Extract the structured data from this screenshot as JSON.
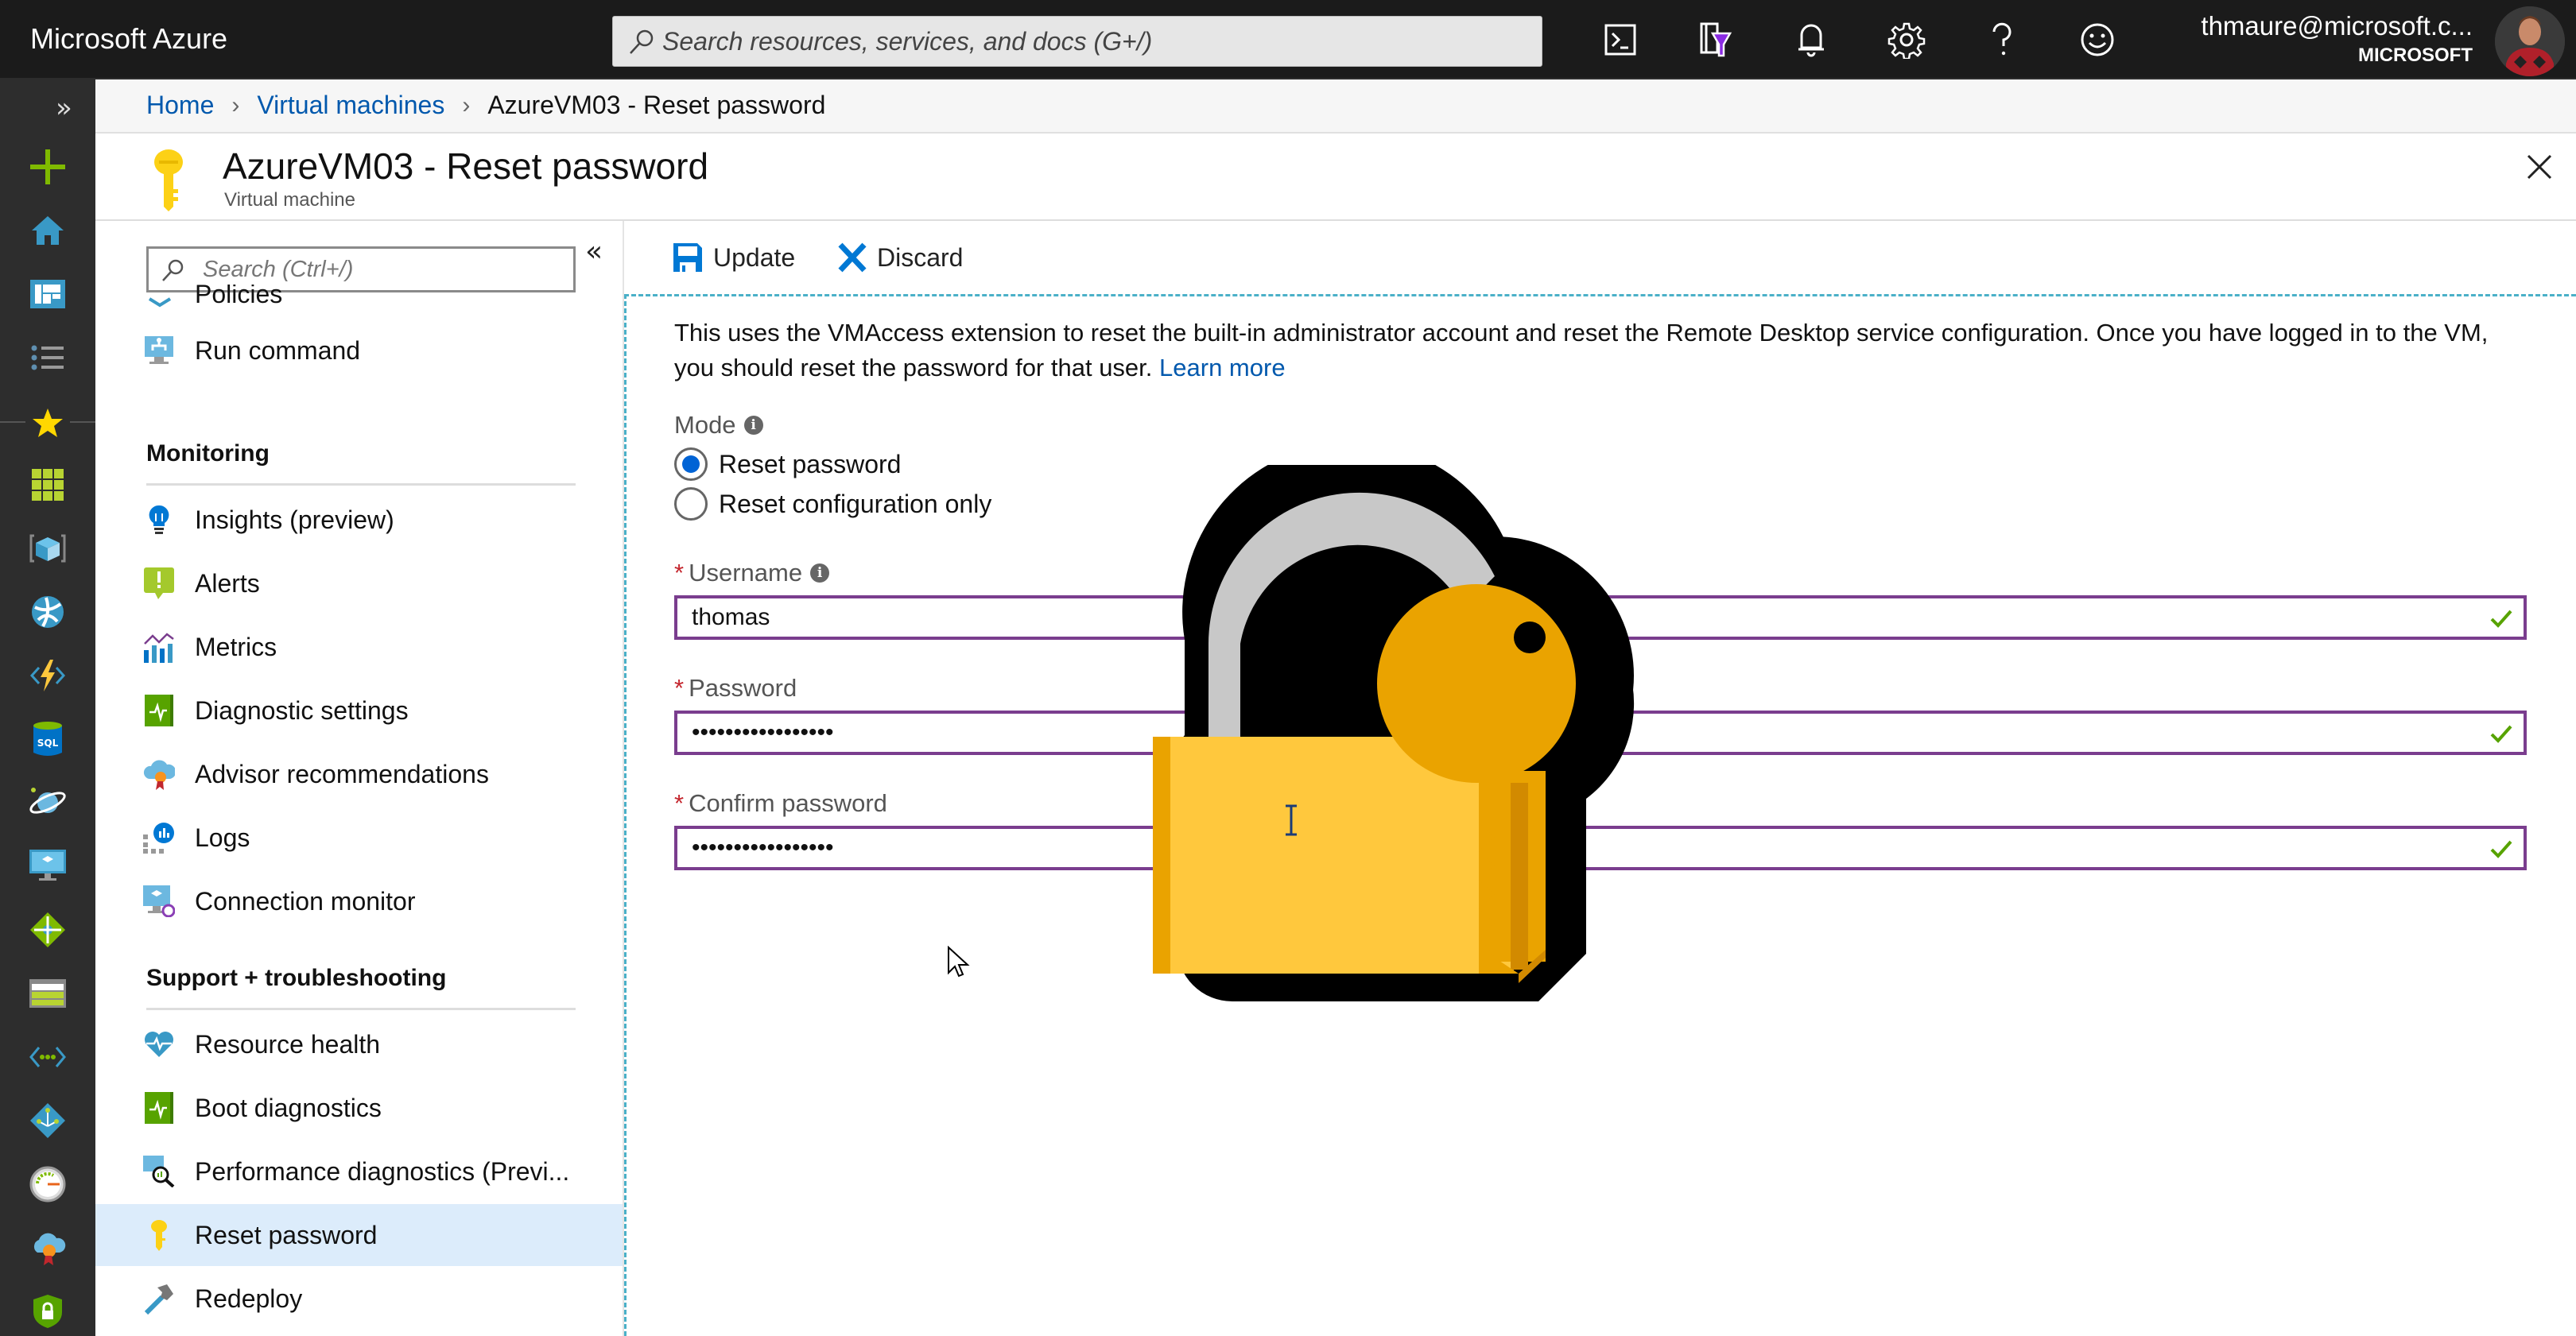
{
  "topbar": {
    "brand": "Microsoft Azure",
    "search_placeholder": "Search resources, services, and docs (G+/)",
    "icons": [
      "cloud-shell-icon",
      "directory-filter-icon",
      "notifications-icon",
      "settings-icon",
      "help-icon",
      "feedback-icon"
    ],
    "user_email": "thmaure@microsoft.c...",
    "user_org": "MICROSOFT"
  },
  "rail": {
    "expand_label": "»",
    "items": [
      {
        "name": "create-resource",
        "color": "#7fba00"
      },
      {
        "name": "home",
        "color": "#3999c6"
      },
      {
        "name": "dashboard",
        "color": "#3999c6"
      },
      {
        "name": "all-services",
        "color": "#888888"
      },
      {
        "name": "favorites",
        "color": "#ffd700"
      },
      {
        "name": "all-resources",
        "color": "#b8d432"
      },
      {
        "name": "resource-groups",
        "color": "#3999c6"
      },
      {
        "name": "app-services",
        "color": "#3999c6"
      },
      {
        "name": "function-apps",
        "color": "#ffc83d"
      },
      {
        "name": "sql-databases",
        "color": "#0072c6"
      },
      {
        "name": "cosmos-db",
        "color": "#3999c6"
      },
      {
        "name": "virtual-machines",
        "color": "#3999c6"
      },
      {
        "name": "load-balancers",
        "color": "#7fba00"
      },
      {
        "name": "storage-accounts",
        "color": "#b8d432"
      },
      {
        "name": "virtual-networks",
        "color": "#3999c6"
      },
      {
        "name": "azure-active-directory",
        "color": "#3999c6"
      },
      {
        "name": "monitor",
        "color": "#7fba00"
      },
      {
        "name": "advisor",
        "color": "#3999c6"
      },
      {
        "name": "security-center",
        "color": "#7fba00"
      }
    ]
  },
  "breadcrumb": {
    "items": [
      "Home",
      "Virtual machines"
    ],
    "current": "AzureVM03 - Reset password",
    "separator": "›"
  },
  "header": {
    "title": "AzureVM03 - Reset password",
    "subtitle": "Virtual machine"
  },
  "blade": {
    "search_placeholder": "Search (Ctrl+/)",
    "collapse_label": "«",
    "partial_item": "Policies",
    "items_top": [
      {
        "label": "Run command",
        "icon": "run-command-icon"
      }
    ],
    "groups": [
      {
        "title": "Monitoring",
        "items": [
          {
            "label": "Insights (preview)",
            "icon": "insights-icon"
          },
          {
            "label": "Alerts",
            "icon": "alerts-icon"
          },
          {
            "label": "Metrics",
            "icon": "metrics-icon"
          },
          {
            "label": "Diagnostic settings",
            "icon": "diagnostic-settings-icon"
          },
          {
            "label": "Advisor recommendations",
            "icon": "advisor-icon"
          },
          {
            "label": "Logs",
            "icon": "logs-icon"
          },
          {
            "label": "Connection monitor",
            "icon": "connection-monitor-icon"
          }
        ]
      },
      {
        "title": "Support + troubleshooting",
        "items": [
          {
            "label": "Resource health",
            "icon": "resource-health-icon"
          },
          {
            "label": "Boot diagnostics",
            "icon": "boot-diagnostics-icon"
          },
          {
            "label": "Performance diagnostics (Previ...",
            "icon": "performance-diagnostics-icon"
          },
          {
            "label": "Reset password",
            "icon": "key-icon",
            "active": true
          },
          {
            "label": "Redeploy",
            "icon": "redeploy-icon"
          }
        ]
      }
    ]
  },
  "toolbar": {
    "update_label": "Update",
    "discard_label": "Discard"
  },
  "form": {
    "description": "This uses the VMAccess extension to reset the built-in administrator account and reset the Remote Desktop service configuration. Once you have logged in to the VM, you should reset the password for that user.",
    "learn_more": "Learn more",
    "mode_label": "Mode",
    "mode_options": [
      "Reset password",
      "Reset configuration only"
    ],
    "mode_selected": "Reset password",
    "username_label": "Username",
    "username_value": "thomas",
    "password_label": "Password",
    "password_value": "•••••••••••••••••",
    "confirm_label": "Confirm password",
    "confirm_value": "•••••••••••••••••",
    "required_marker": "*",
    "info_glyph": "i",
    "field_border_color": "#7a3d8e",
    "valid_color": "#57a300"
  }
}
